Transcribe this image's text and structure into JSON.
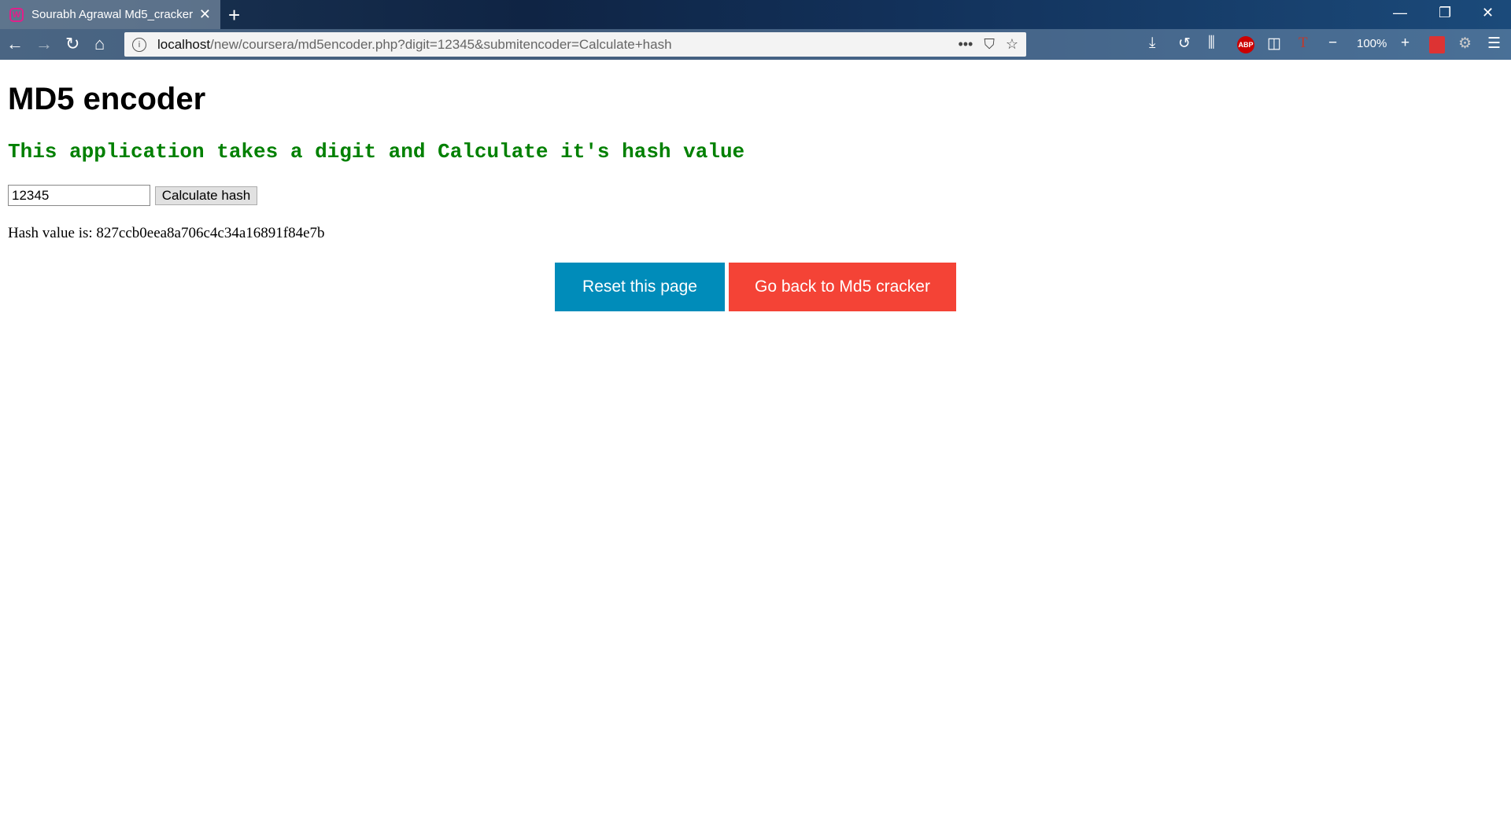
{
  "browser": {
    "tab_title": "Sourabh Agrawal Md5_cracker",
    "url_host": "localhost",
    "url_path": "/new/coursera/md5encoder.php?digit=12345&submitencoder=Calculate+hash",
    "zoom": "100%",
    "abp_label": "ABP"
  },
  "page": {
    "title": "MD5 encoder",
    "subtitle": "This application takes a digit and Calculate it's hash value",
    "digit_value": "12345",
    "calc_label": "Calculate hash",
    "hash_text": "Hash value is: 827ccb0eea8a706c4c34a16891f84e7b",
    "reset_label": "Reset this page",
    "back_label": "Go back to Md5 cracker"
  },
  "colors": {
    "reset": "#008cba",
    "back": "#f44336",
    "subtitle": "#008000"
  }
}
